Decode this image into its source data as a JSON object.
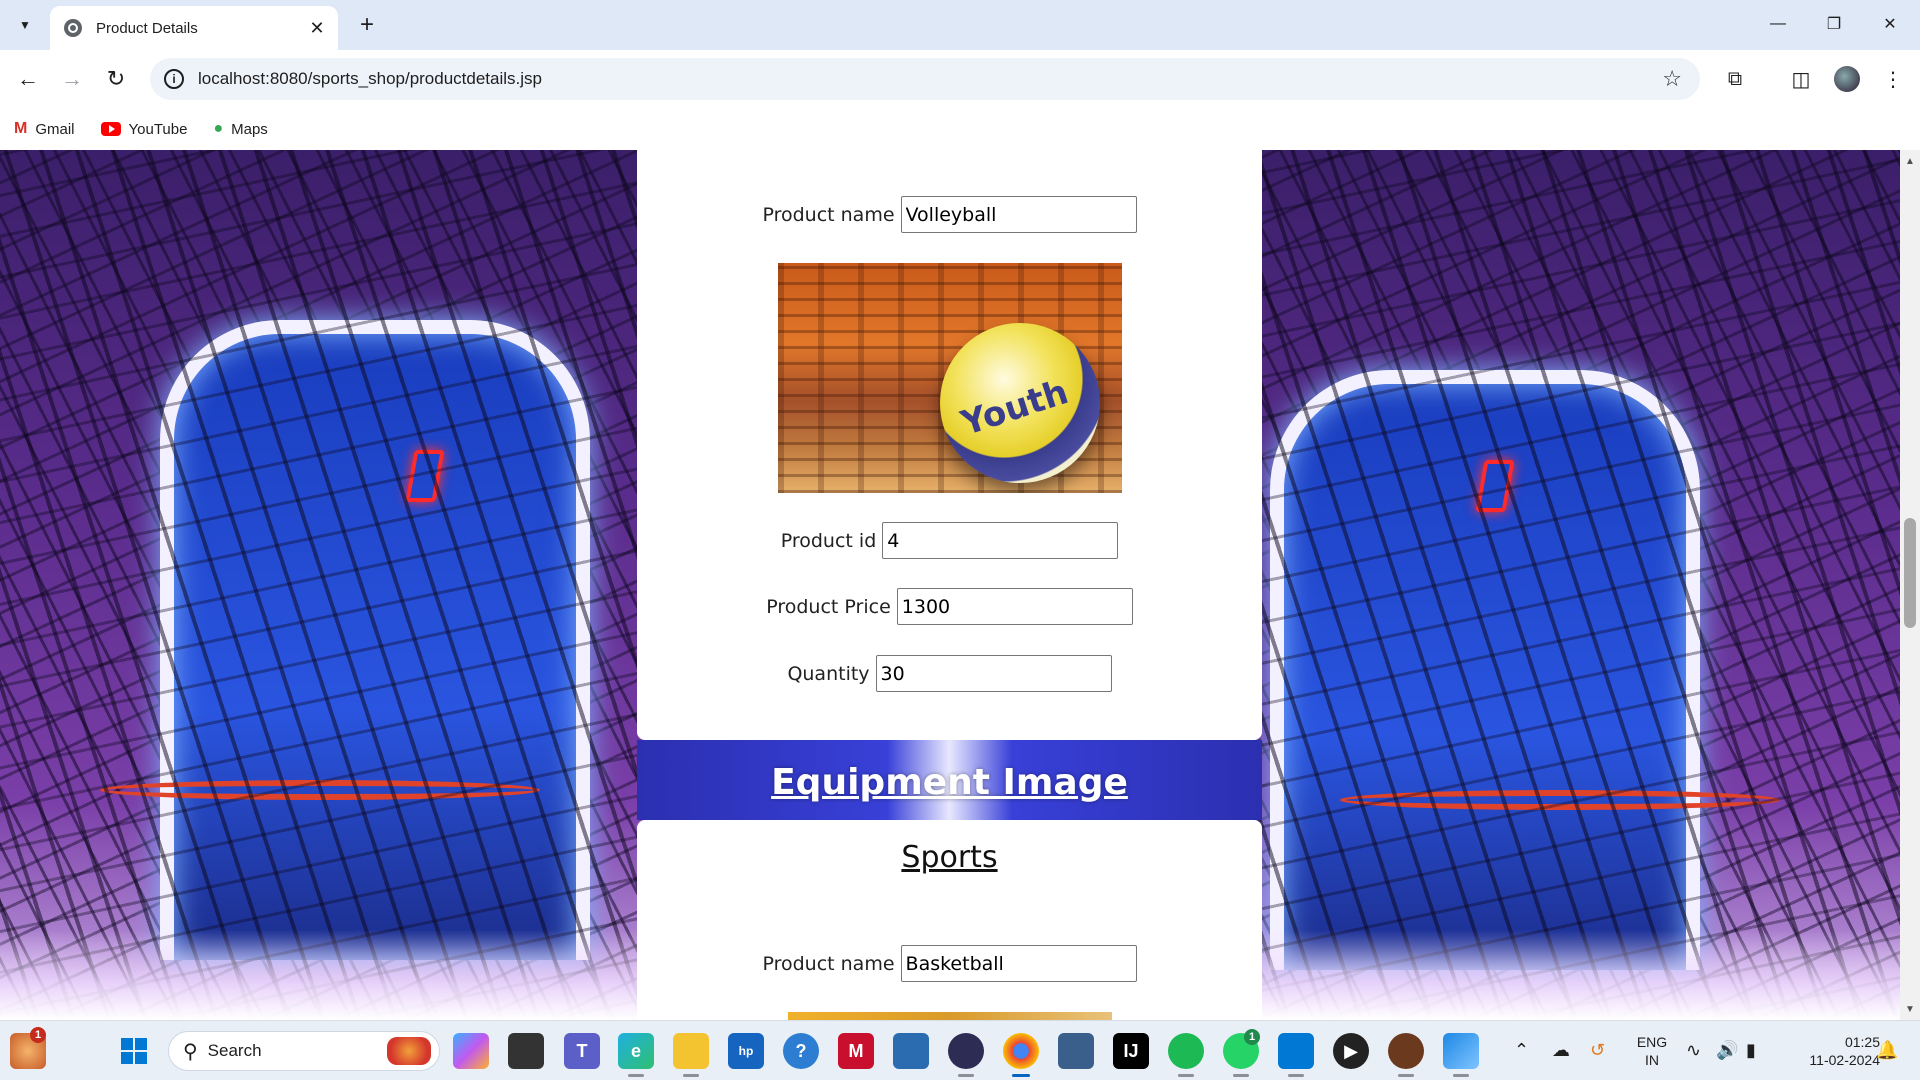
{
  "browser": {
    "tab_title": "Product Details",
    "url": "localhost:8080/sports_shop/productdetails.jsp",
    "bookmarks": [
      {
        "label": "Gmail",
        "icon": "gmail-icon"
      },
      {
        "label": "YouTube",
        "icon": "youtube-icon"
      },
      {
        "label": "Maps",
        "icon": "maps-icon"
      }
    ]
  },
  "page": {
    "product1": {
      "name_label": "Product name",
      "name_value": "Volleyball",
      "image_text": "Youth",
      "id_label": "Product id",
      "id_value": "4",
      "price_label": "Product Price",
      "price_value": "1300",
      "qty_label": "Quantity",
      "qty_value": "30"
    },
    "banner_title": "Equipment Image",
    "product2": {
      "category_title": "Sports",
      "name_label": "Product name",
      "name_value": "Basketball"
    }
  },
  "taskbar": {
    "search_placeholder": "Search",
    "lang_line1": "ENG",
    "lang_line2": "IN",
    "time": "01:25",
    "date": "11-02-2024",
    "weather_badge": "1",
    "whatsapp_badge": "1"
  },
  "colors": {
    "taskbar_bg": "#e9eff7",
    "tab_strip_bg": "#dfe8f6",
    "accent": "#0067c0"
  }
}
